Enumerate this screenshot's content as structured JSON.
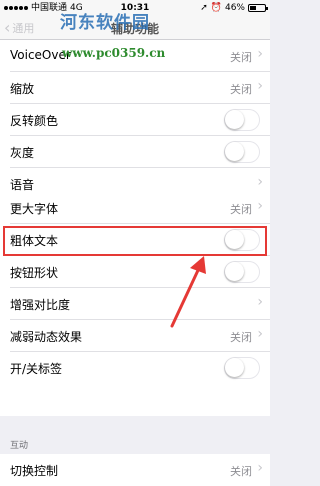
{
  "status": {
    "carrier": "中国联通",
    "network": "4G",
    "time": "10:31",
    "battery_text": "46%",
    "battery_level": 0.46
  },
  "nav": {
    "back_label": "通用",
    "title": "辅助功能"
  },
  "watermark": {
    "site_name": "河东软件园",
    "url": "www.pc0359.cn"
  },
  "group1": [
    {
      "label": "VoiceOver",
      "value": "关闭",
      "type": "chevron"
    },
    {
      "label": "缩放",
      "value": "关闭",
      "type": "chevron"
    },
    {
      "label": "反转颜色",
      "type": "toggle",
      "on": false
    },
    {
      "label": "灰度",
      "type": "toggle",
      "on": false
    },
    {
      "label": "语音",
      "type": "chevron"
    }
  ],
  "group2": [
    {
      "label": "更大字体",
      "value": "关闭",
      "type": "chevron"
    },
    {
      "label": "粗体文本",
      "type": "toggle",
      "on": false
    },
    {
      "label": "按钮形状",
      "type": "toggle",
      "on": false
    },
    {
      "label": "增强对比度",
      "type": "chevron"
    },
    {
      "label": "减弱动态效果",
      "value": "关闭",
      "type": "chevron"
    },
    {
      "label": "开/关标签",
      "type": "toggle",
      "on": false
    }
  ],
  "section_interaction": {
    "header": "互动",
    "rows": [
      {
        "label": "切换控制",
        "value": "关闭",
        "type": "chevron"
      }
    ]
  },
  "colors": {
    "highlight": "#e53935",
    "arrow": "#e53935",
    "watermark": "#2a6fb5",
    "watermark_url": "#2e8b2e"
  },
  "annotation": {
    "highlighted_row": "粗体文本"
  }
}
